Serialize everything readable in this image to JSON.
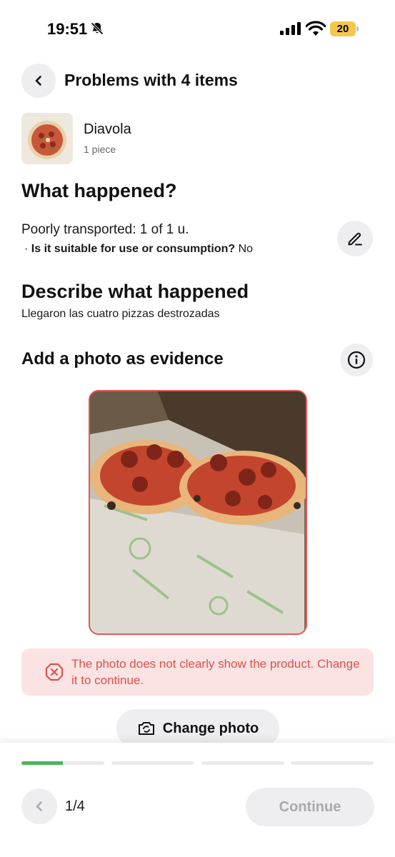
{
  "status_bar": {
    "time": "19:51",
    "battery_level": "20"
  },
  "header": {
    "title": "Problems with 4 items"
  },
  "product": {
    "name": "Diavola",
    "quantity": "1 piece"
  },
  "what_happened": {
    "title": "What happened?",
    "reason": "Poorly transported: 1 of 1 u.",
    "suitable_prefix": "· ",
    "suitable_question": "Is it suitable for use or consumption?",
    "suitable_answer": " No"
  },
  "describe": {
    "title": "Describe what happened",
    "text": "Llegaron las cuatro pizzas destrozadas"
  },
  "photo_section": {
    "title": "Add a photo as evidence"
  },
  "error": {
    "message": "The photo does not clearly show the product. Change it to continue."
  },
  "change_photo": {
    "label": "Change photo"
  },
  "footer": {
    "step_text": "1/4",
    "continue_label": "Continue",
    "progress": [
      0.5,
      0,
      0,
      0
    ]
  },
  "colors": {
    "accent_green": "#4cb55a",
    "error_red": "#d9534f",
    "error_bg": "#fbe3e3",
    "disabled_text": "#a9a9ae"
  }
}
